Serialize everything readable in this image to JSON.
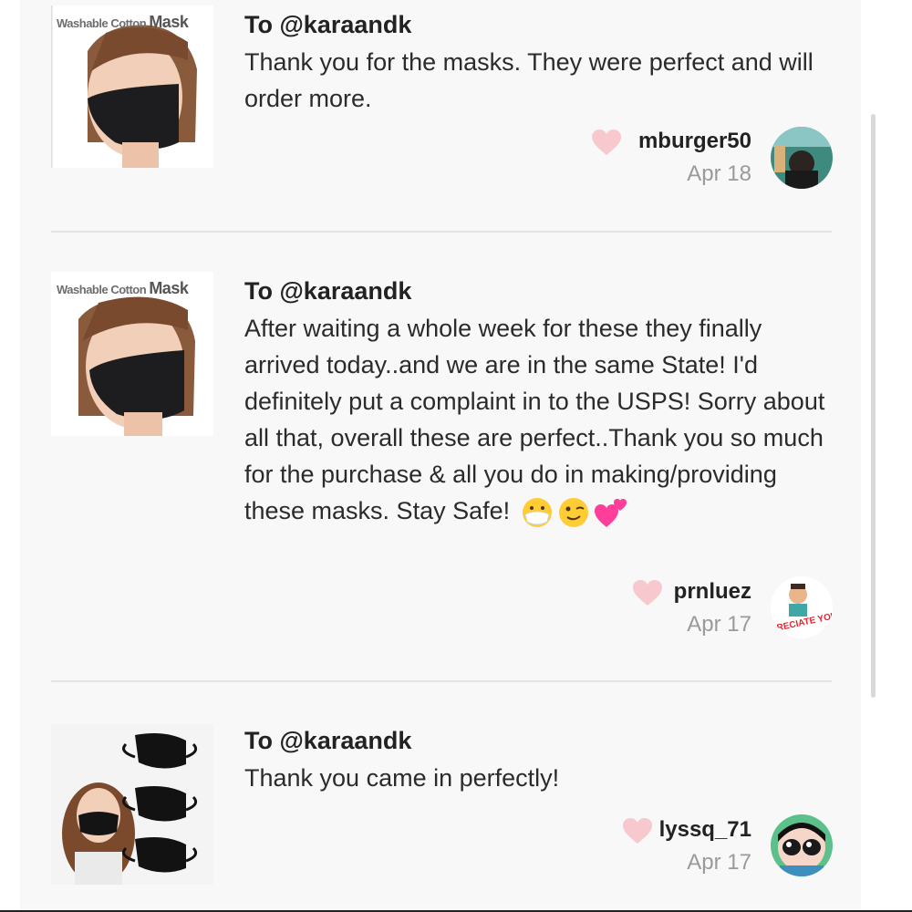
{
  "reviews": [
    {
      "recipient": "To @karaandk",
      "message": "Thank you for the masks. They were perfect and will order more.",
      "username": "mburger50",
      "date": "Apr 18",
      "thumbnail_brand_prefix": "Washable Cotton",
      "thumbnail_brand_main": "Mask"
    },
    {
      "recipient": "To @karaandk",
      "message": "After waiting a whole week for these they finally arrived today..and we are in the same State! I'd definitely put a complaint in to the USPS! Sorry about all that, overall these are perfect..Thank you so much for the purchase & all you do in making/providing these masks. Stay Safe!",
      "username": "prnluez",
      "date": "Apr 17",
      "thumbnail_brand_prefix": "Washable Cotton",
      "thumbnail_brand_main": "Mask",
      "avatar_sticker_text": "PPRECIATE YOU"
    },
    {
      "recipient": "To @karaandk",
      "message": "Thank you came in perfectly!",
      "username": "lyssq_71",
      "date": "Apr 17"
    }
  ],
  "icons": {
    "like": "heart-icon",
    "emojis": [
      "face-with-medical-mask-emoji",
      "winking-face-emoji",
      "two-hearts-emoji"
    ]
  },
  "colors": {
    "heart": "#f7c9cf",
    "divider": "#e8e3e3",
    "date": "#9a9a9a"
  }
}
